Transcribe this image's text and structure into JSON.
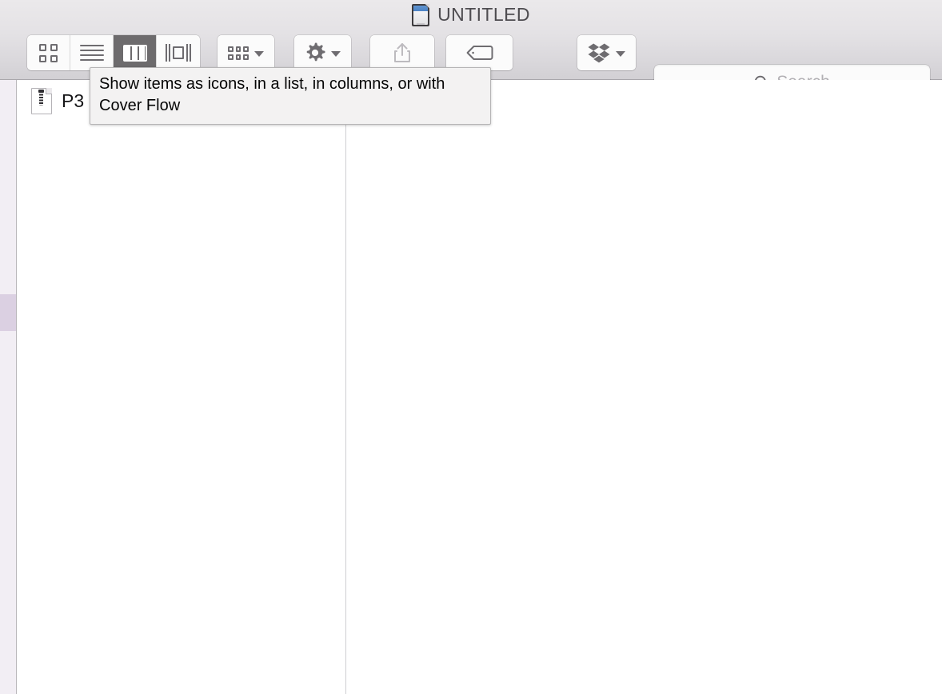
{
  "window": {
    "title": "UNTITLED",
    "title_icon": "sd-card-icon"
  },
  "toolbar": {
    "view_modes": [
      {
        "id": "icon-view",
        "icon": "grid-icon",
        "label": "Icon view",
        "selected": false
      },
      {
        "id": "list-view",
        "icon": "list-icon",
        "label": "List view",
        "selected": false
      },
      {
        "id": "column-view",
        "icon": "columns-icon",
        "label": "Column view",
        "selected": true
      },
      {
        "id": "coverflow-view",
        "icon": "cover-flow-icon",
        "label": "Cover Flow view",
        "selected": false
      }
    ],
    "arrange": {
      "icon": "arrange-icon",
      "label": "Arrange items",
      "has_menu": true
    },
    "action": {
      "icon": "gear-icon",
      "label": "Action",
      "has_menu": true
    },
    "share": {
      "icon": "share-icon",
      "label": "Share",
      "disabled": true
    },
    "tags": {
      "icon": "tag-icon",
      "label": "Edit tags"
    },
    "dropbox": {
      "icon": "dropbox-icon",
      "label": "Dropbox",
      "has_menu": true
    },
    "search": {
      "icon": "search-icon",
      "placeholder": "Search",
      "value": ""
    }
  },
  "tooltip": {
    "text": "Show items as icons, in a list, in columns, or with Cover Flow"
  },
  "sidebar": {
    "selected_item": ""
  },
  "columns": [
    {
      "id": "column-1",
      "items": [
        {
          "name": "P3",
          "icon": "document-icon"
        }
      ]
    },
    {
      "id": "column-2",
      "items": []
    }
  ],
  "colors": {
    "titlebar_top": "#ebe9eb",
    "titlebar_bottom": "#d2d0d4",
    "selected_segment": "#6d6b6d",
    "sidebar_bg": "#f2eef4",
    "sidebar_selection": "#dbd0e2",
    "tooltip_bg": "#f3f2f2",
    "accent_blue": "#4b83c6"
  }
}
